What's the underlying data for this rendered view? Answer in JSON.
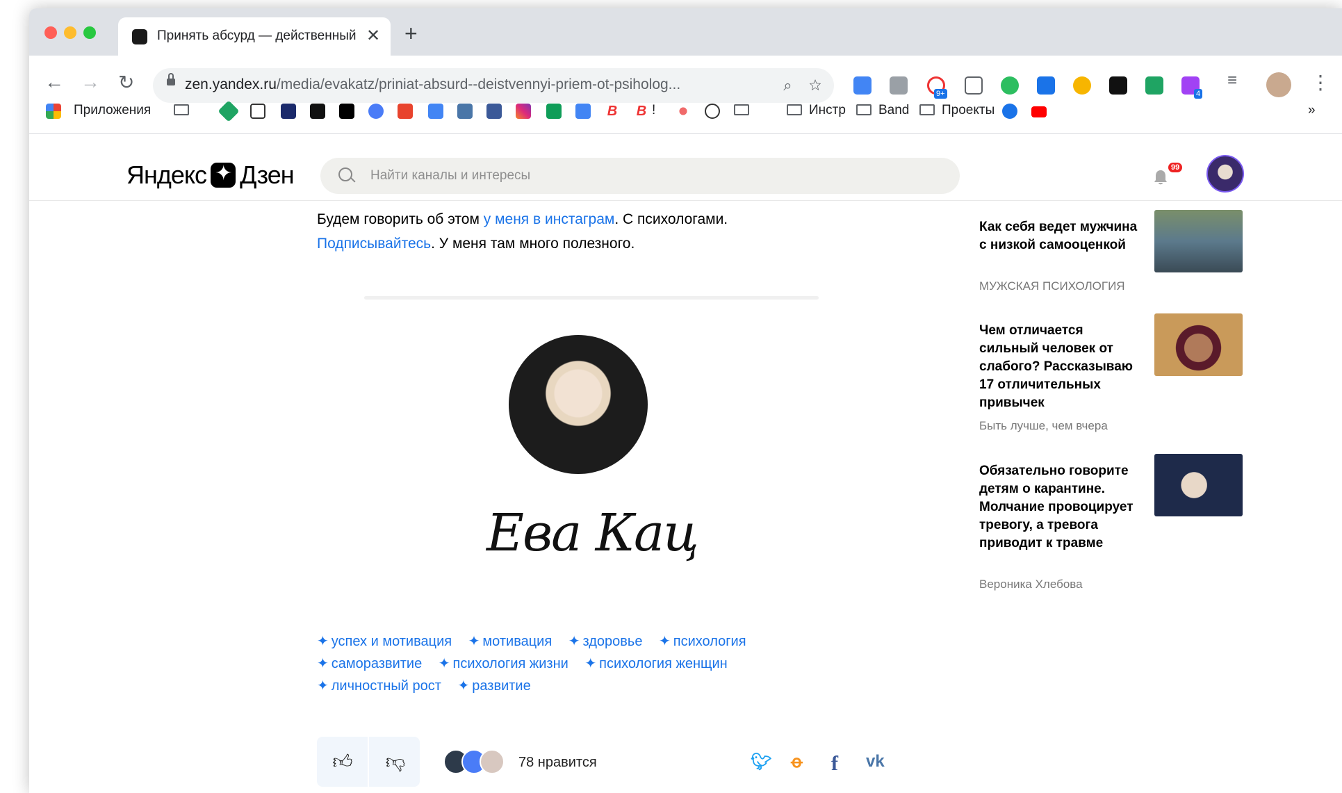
{
  "browser": {
    "tab_title": "Принять абсурд — действенный прием от психолога",
    "new_tab": "+",
    "url_domain": "zen.yandex.ru",
    "url_path": "/media/evakatz/priniat-absurd--deistvennyi-priem-ot-psiholog...",
    "ext_badge_1": "9+",
    "ext_badge_2": "4",
    "bookmarks": {
      "apps": "Приложения",
      "excl": "!",
      "instr": "Инстр",
      "band": "Band",
      "projects": "Проекты",
      "more": "»"
    }
  },
  "zen": {
    "logo_left": "Яндекс",
    "logo_right": "Дзен",
    "search_placeholder": "Найти каналы и интересы",
    "notif_count": "99"
  },
  "article": {
    "p1_a": "Будем говорить об этом ",
    "p1_link": "у меня в инстаграм",
    "p1_b": ". С психологами.",
    "p2_link": "Подписывайтесь",
    "p2_b": ". У меня там много полезного.",
    "signature": "Ева Кац",
    "tags": [
      "успех и мотивация",
      "мотивация",
      "здоровье",
      "психология",
      "саморазвитие",
      "психология жизни",
      "психология женщин",
      "личностный рост",
      "развитие"
    ],
    "likes": "78 нравится"
  },
  "share": {
    "twitter": "t",
    "ok": "ok",
    "facebook": "f",
    "vk": "vk"
  },
  "sidebar": [
    {
      "title": "Как себя ведет мужчина с низкой самооценкой",
      "source": "МУЖСКАЯ ПСИХОЛОГИЯ"
    },
    {
      "title": "Чем отличается сильный человек от слабого? Рассказываю 17 отличительных привычек",
      "source": "Быть лучше, чем вчера"
    },
    {
      "title": "Обязательно говорите детям о карантине. Молчание провоцирует тревогу, а тревога приводит к травме",
      "source": "Вероника Хлебова"
    }
  ]
}
